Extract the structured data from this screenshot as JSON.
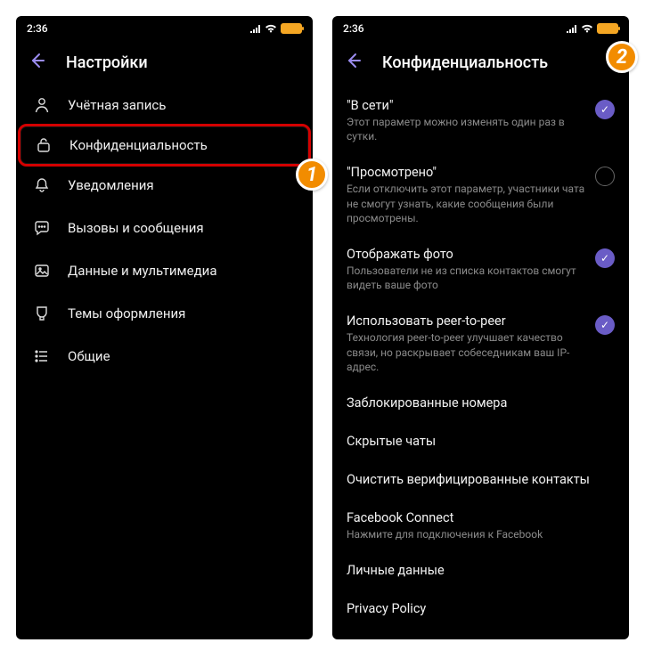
{
  "status": {
    "time": "2:36"
  },
  "left": {
    "header_title": "Настройки",
    "items": [
      {
        "label": "Учётная запись"
      },
      {
        "label": "Конфиденциальность"
      },
      {
        "label": "Уведомления"
      },
      {
        "label": "Вызовы и сообщения"
      },
      {
        "label": "Данные и мультимедиа"
      },
      {
        "label": "Темы оформления"
      },
      {
        "label": "Общие"
      }
    ]
  },
  "right": {
    "header_title": "Конфиденциальность",
    "items": [
      {
        "title": "\"В сети\"",
        "desc": "Этот параметр можно изменять один раз в сутки.",
        "checked": true
      },
      {
        "title": "\"Просмотрено\"",
        "desc": "Если отключить этот параметр, участники чата не смогут узнать, какие сообщения были просмотрены.",
        "checked": false
      },
      {
        "title": "Отображать фото",
        "desc": "Пользователи не из списка контактов смогут видеть ваше фото",
        "checked": true
      },
      {
        "title": "Использовать peer-to-peer",
        "desc": "Технология peer-to-peer улучшает качество связи, но раскрывает собеседникам ваш IP-адрес.",
        "checked": true
      },
      {
        "title": "Заблокированные номера",
        "desc": ""
      },
      {
        "title": "Скрытые чаты",
        "desc": ""
      },
      {
        "title": "Очистить верифицированные контакты",
        "desc": ""
      },
      {
        "title": "Facebook Connect",
        "desc": "Нажмите для подключения к Facebook"
      },
      {
        "title": "Личные данные",
        "desc": ""
      },
      {
        "title": "Privacy Policy",
        "desc": ""
      }
    ]
  },
  "badges": {
    "one": "1",
    "two": "2"
  }
}
